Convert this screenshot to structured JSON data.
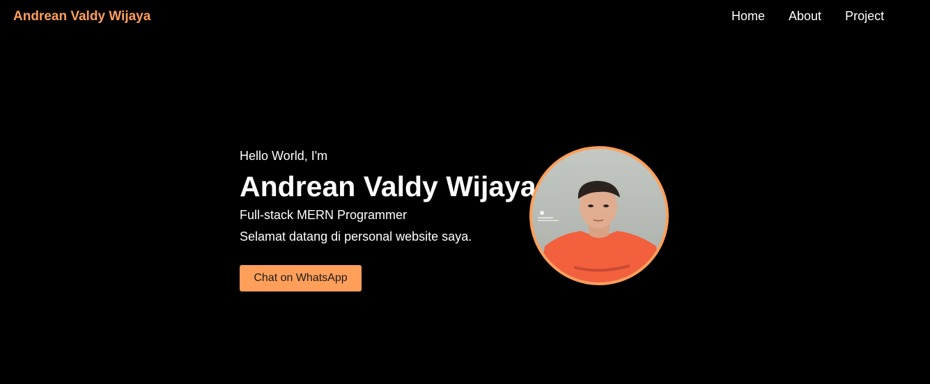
{
  "navbar": {
    "brand": "Andrean Valdy Wijaya",
    "links": [
      {
        "label": "Home"
      },
      {
        "label": "About"
      },
      {
        "label": "Project"
      }
    ]
  },
  "hero": {
    "greeting": "Hello World, I'm",
    "name": "Andrean Valdy Wijaya",
    "role": "Full-stack MERN Programmer",
    "welcome": "Selamat datang di personal website saya.",
    "cta_label": "Chat on WhatsApp"
  },
  "colors": {
    "accent": "#ff9f5a",
    "background": "#000000",
    "text": "#ffffff"
  }
}
